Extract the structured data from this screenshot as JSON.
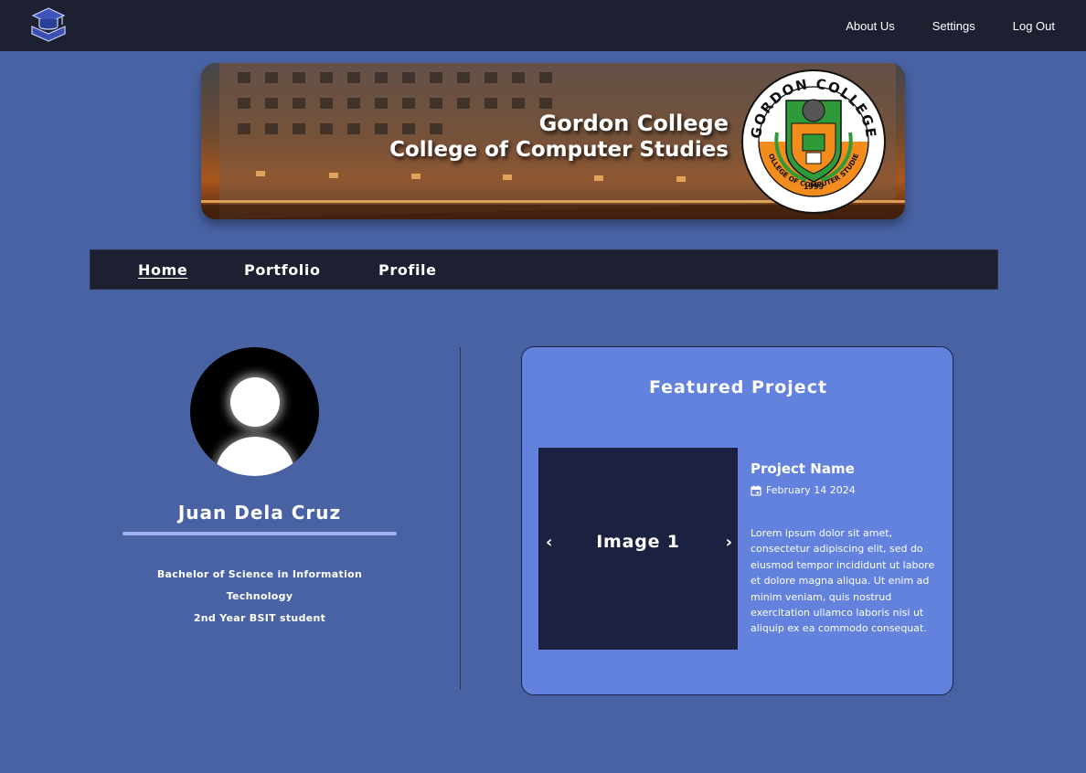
{
  "topbar": {
    "links": [
      "About Us",
      "Settings",
      "Log Out"
    ]
  },
  "banner": {
    "line1": "Gordon College",
    "line2": "College of Computer Studies",
    "seal_top": "GORDON COLLEGE",
    "seal_year": "1999",
    "seal_bottom": "COLLEGE OF COMPUTER STUDIES"
  },
  "nav": {
    "home": "Home",
    "portfolio": "Portfolio",
    "profile": "Profile"
  },
  "profile": {
    "name": "Juan Dela Cruz",
    "course": "Bachelor of Science in Information Technology",
    "year": "2nd Year BSIT student"
  },
  "featured": {
    "title": "Featured Project",
    "image_label": "Image 1",
    "project_name": "Project Name",
    "date": "February 14 2024",
    "description": "Lorem ipsum dolor sit amet, consectetur adipiscing elit, sed do eiusmod tempor incididunt ut labore et dolore magna aliqua. Ut enim ad minim veniam, quis nostrud exercitation ullamco laboris nisi ut aliquip ex ea commodo consequat."
  },
  "colors": {
    "background": "#4862a3",
    "navbar": "#1c2030",
    "card": "#6282de",
    "carousel": "#1c2142",
    "accent_line": "#a3b1f2"
  }
}
